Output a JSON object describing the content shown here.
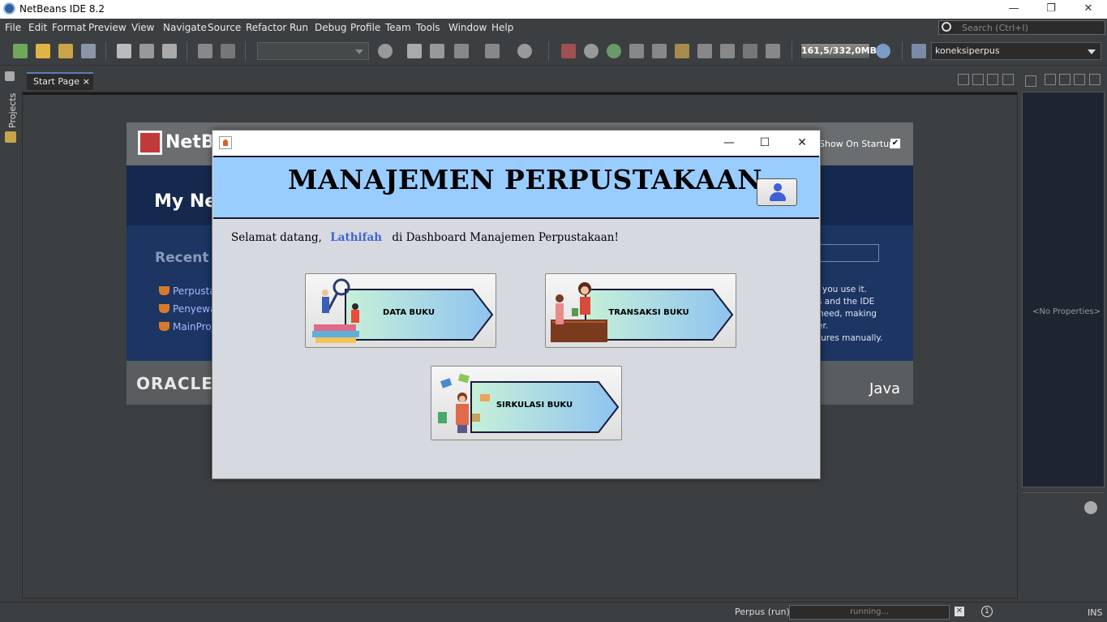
{
  "window": {
    "title": "NetBeans IDE 8.2",
    "controls": [
      "—",
      "❐",
      "✕"
    ]
  },
  "menubar": {
    "items": [
      {
        "label": "File"
      },
      {
        "label": "Edit"
      },
      {
        "label": "Format"
      },
      {
        "label": "Preview"
      },
      {
        "label": "View"
      },
      {
        "label": "Navigate"
      },
      {
        "label": "Source"
      },
      {
        "label": "Refactor"
      },
      {
        "label": "Run"
      },
      {
        "label": "Debug"
      },
      {
        "label": "Profile"
      },
      {
        "label": "Team"
      },
      {
        "label": "Tools"
      },
      {
        "label": "Window"
      },
      {
        "label": "Help"
      }
    ],
    "search_placeholder": "Search (Ctrl+I)"
  },
  "toolbar": {
    "memory": "161,5/332,0MB",
    "project": "koneksiperpus"
  },
  "sidebar": {
    "projects_label": "Projects"
  },
  "editor": {
    "tab_label": "Start Page",
    "tab_close": "×"
  },
  "startpage": {
    "logo_text": "NetBea",
    "show_on_startup": "Show On Startup",
    "my_netbeans": "My Ne",
    "recent": "Recent",
    "recent_items": [
      {
        "label": "Perpusta"
      },
      {
        "label": "Penyewa"
      },
      {
        "label": "MainProj"
      }
    ],
    "info_lines": [
      "you use it.",
      "s and the IDE",
      "need, making",
      "er.",
      "tures manually."
    ],
    "oracle": "ORACLE",
    "java": "Java"
  },
  "properties": {
    "empty": "<No Properties>"
  },
  "statusbar": {
    "run_label": "Perpus (run)",
    "progress": "running...",
    "ins": "INS"
  },
  "dialog": {
    "controls": [
      "—",
      "☐",
      "✕"
    ],
    "heading": "MANAJEMEN PERPUSTAKAAN",
    "welcome_before": "Selamat datang,",
    "user_name": "Lathifah",
    "welcome_after": "di Dashboard Manajemen Perpustakaan!",
    "buttons": [
      {
        "label": "DATA BUKU"
      },
      {
        "label": "TRANSAKSI BUKU"
      },
      {
        "label": "SIRKULASI BUKU"
      }
    ],
    "colors": {
      "header": "#99ccff",
      "name": "#3b66d6",
      "arrow_left": "#c6f0d8",
      "arrow_right": "#8fc3f0"
    }
  }
}
